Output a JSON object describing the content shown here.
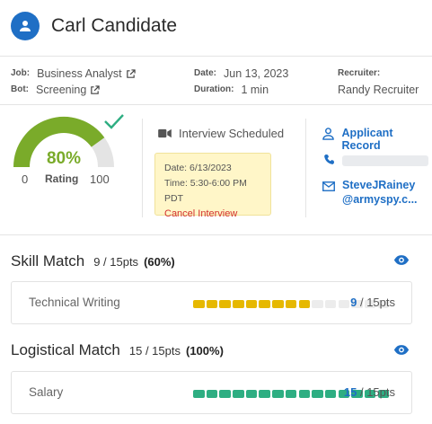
{
  "candidate": {
    "name": "Carl Candidate"
  },
  "meta": {
    "job_label": "Job:",
    "job_value": "Business Analyst",
    "bot_label": "Bot:",
    "bot_value": "Screening",
    "date_label": "Date:",
    "date_value": "Jun 13, 2023",
    "duration_label": "Duration:",
    "duration_value": "1 min",
    "recruiter_label": "Recruiter:",
    "recruiter_value": "Randy Recruiter"
  },
  "rating": {
    "percent_text": "80%",
    "percent": 80,
    "label": "Rating",
    "min": "0",
    "max": "100"
  },
  "interview": {
    "status": "Interview Scheduled",
    "date_line": "Date: 6/13/2023",
    "time_line": "Time: 5:30-6:00 PM PDT",
    "cancel_label": "Cancel Interview"
  },
  "contact": {
    "record_label": "Applicant Record",
    "email_line1": "SteveJRainey",
    "email_line2": "@armyspy.c..."
  },
  "skill_match": {
    "title": "Skill Match",
    "points_text": "9 / 15pts",
    "percent_text": "(60%)",
    "items": [
      {
        "label": "Technical Writing",
        "score": "9",
        "total": " / 15pts",
        "filled": 9,
        "segments": 15,
        "color": "#e6b800"
      }
    ]
  },
  "logistical_match": {
    "title": "Logistical Match",
    "points_text": "15 / 15pts",
    "percent_text": "(100%)",
    "items": [
      {
        "label": "Salary",
        "score": "15",
        "total": " / 15pts",
        "filled": 15,
        "segments": 15,
        "color": "#2eae82"
      }
    ]
  },
  "colors": {
    "accent": "#1f6fc5",
    "gauge_fill": "#7aab2a",
    "gauge_track": "#e4e4e4",
    "check": "#2eae82",
    "cancel": "#d33131"
  }
}
